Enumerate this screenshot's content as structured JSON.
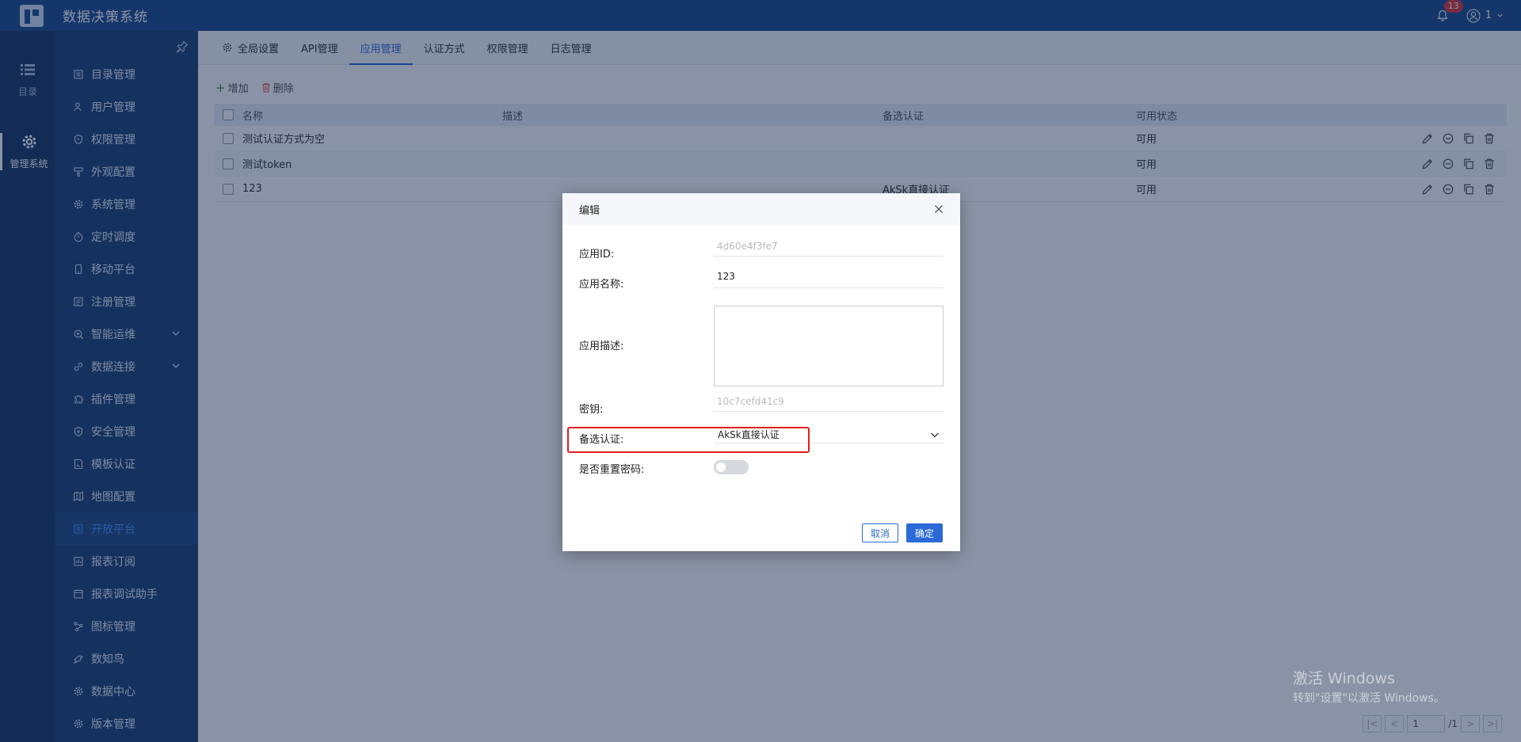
{
  "app": {
    "title": "数据决策系统",
    "notification_count": "13",
    "user_name": "1"
  },
  "rail": {
    "items": [
      {
        "label": "目录",
        "icon": "list-icon"
      },
      {
        "label": "管理系统",
        "icon": "gear-icon"
      }
    ]
  },
  "sidebar": {
    "items": [
      {
        "label": "目录管理",
        "icon": "catalog-icon"
      },
      {
        "label": "用户管理",
        "icon": "user-icon"
      },
      {
        "label": "权限管理",
        "icon": "permission-icon"
      },
      {
        "label": "外观配置",
        "icon": "paint-icon"
      },
      {
        "label": "系统管理",
        "icon": "gear-icon"
      },
      {
        "label": "定时调度",
        "icon": "timer-icon"
      },
      {
        "label": "移动平台",
        "icon": "mobile-icon"
      },
      {
        "label": "注册管理",
        "icon": "register-icon"
      },
      {
        "label": "智能运维",
        "icon": "ops-icon",
        "expandable": true
      },
      {
        "label": "数据连接",
        "icon": "link-icon",
        "expandable": true
      },
      {
        "label": "插件管理",
        "icon": "plugin-icon"
      },
      {
        "label": "安全管理",
        "icon": "shield-icon"
      },
      {
        "label": "模板认证",
        "icon": "template-icon"
      },
      {
        "label": "地图配置",
        "icon": "map-icon"
      },
      {
        "label": "开放平台",
        "icon": "open-platform-icon",
        "active": true
      },
      {
        "label": "报表订阅",
        "icon": "subscribe-icon"
      },
      {
        "label": "报表调试助手",
        "icon": "debug-icon"
      },
      {
        "label": "图标管理",
        "icon": "chart-icon"
      },
      {
        "label": "数知鸟",
        "icon": "bird-icon"
      },
      {
        "label": "数据中心",
        "icon": "data-center-icon"
      },
      {
        "label": "版本管理",
        "icon": "version-icon"
      }
    ]
  },
  "tabs": [
    {
      "label": "全局设置",
      "icon": "gear-icon"
    },
    {
      "label": "API管理"
    },
    {
      "label": "应用管理",
      "active": true
    },
    {
      "label": "认证方式"
    },
    {
      "label": "权限管理"
    },
    {
      "label": "日志管理"
    }
  ],
  "toolbar": {
    "add_label": "增加",
    "delete_label": "删除"
  },
  "table": {
    "headers": {
      "name": "名称",
      "desc": "描述",
      "alt_auth": "备选认证",
      "status": "可用状态"
    },
    "rows": [
      {
        "name": "测试认证方式为空",
        "desc": "",
        "alt_auth": "",
        "status": "可用"
      },
      {
        "name": "测试token",
        "desc": "",
        "alt_auth": "",
        "status": "可用"
      },
      {
        "name": "123",
        "desc": "",
        "alt_auth": "AkSk直接认证",
        "status": "可用"
      }
    ]
  },
  "pager": {
    "current": "1",
    "total": "/1"
  },
  "watermark": {
    "line1": "激活 Windows",
    "line2": "转到\"设置\"以激活 Windows。"
  },
  "modal": {
    "title": "编辑",
    "app_id_label": "应用ID:",
    "app_id_value": "4d60e4f3fe7",
    "app_name_label": "应用名称:",
    "app_name_value": "123",
    "app_desc_label": "应用描述:",
    "app_desc_value": "",
    "secret_label": "密钥:",
    "secret_value": "10c7cefd41c9",
    "alt_auth_label": "备选认证:",
    "alt_auth_value": "AkSk直接认证",
    "reset_pwd_label": "是否重置密码:",
    "reset_pwd_on": false,
    "cancel_label": "取消",
    "ok_label": "确定"
  },
  "colors": {
    "topbar": "#1f4e8c",
    "sidebar": "#1f4577",
    "accent": "#2b6ad6",
    "highlight": "#e01e1e"
  }
}
